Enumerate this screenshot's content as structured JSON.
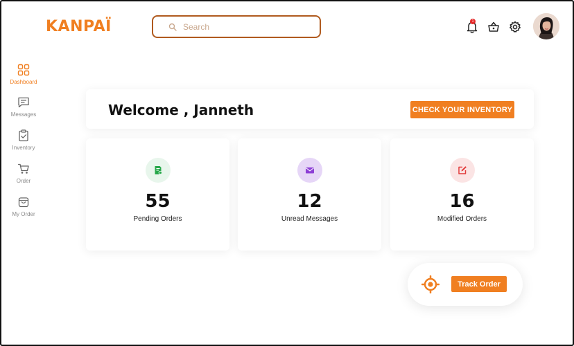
{
  "brand": {
    "logo": "KANPAÏ",
    "accent": "#f07f21"
  },
  "search": {
    "placeholder": "Search",
    "value": ""
  },
  "header": {
    "notification_count": "1"
  },
  "sidebar": {
    "items": [
      {
        "label": "Dashboard",
        "icon": "grid-icon",
        "active": true
      },
      {
        "label": "Messages",
        "icon": "message-icon"
      },
      {
        "label": "Inventory",
        "icon": "clipboard-check-icon"
      },
      {
        "label": "Order",
        "icon": "cart-icon"
      },
      {
        "label": "My Order",
        "icon": "bag-icon"
      }
    ]
  },
  "welcome": {
    "title": "Welcome , Janneth",
    "cta_label": "CHECK YOUR INVENTORY"
  },
  "stats": [
    {
      "value": "55",
      "label": "Pending Orders",
      "icon": "order-doc-icon",
      "icon_color": "#27a84a",
      "bg": "#e8f6ec"
    },
    {
      "value": "12",
      "label": "Unread Messages",
      "icon": "envelope-icon",
      "icon_color": "#8d3fd6",
      "bg": "#e6d6f7"
    },
    {
      "value": "16",
      "label": "Modified Orders",
      "icon": "edit-icon",
      "icon_color": "#e23b3b",
      "bg": "#fbe4e4"
    }
  ],
  "track": {
    "button_label": "Track Order"
  }
}
